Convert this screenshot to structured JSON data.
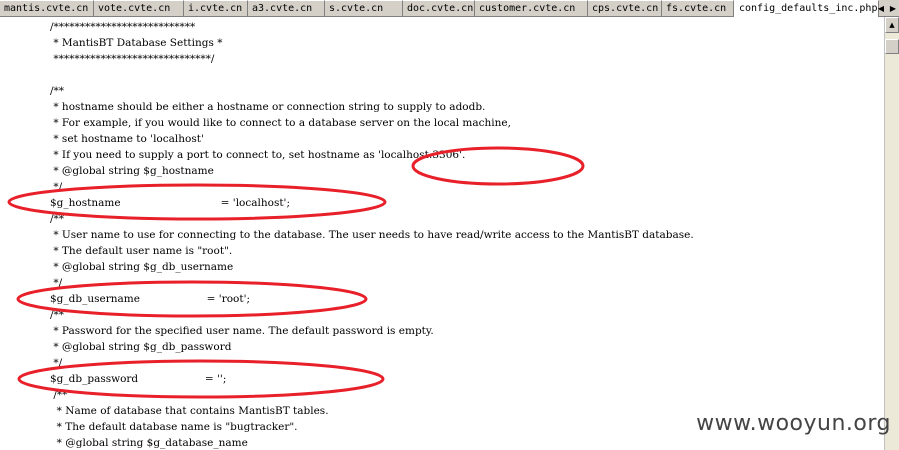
{
  "tabs": [
    {
      "label": "mantis.cvte.cn",
      "active": false
    },
    {
      "label": "vote.cvte.cn",
      "active": false
    },
    {
      "label": "i.cvte.cn",
      "active": false
    },
    {
      "label": "a3.cvte.cn",
      "active": false
    },
    {
      "label": "s.cvte.cn",
      "active": false
    },
    {
      "label": "doc.cvte.cn",
      "active": false
    },
    {
      "label": "customer.cvte.cn",
      "active": false
    },
    {
      "label": "cps.cvte.cn",
      "active": false
    },
    {
      "label": "fs.cvte.cn",
      "active": false
    },
    {
      "label": "config_defaults_inc.php",
      "active": true
    }
  ],
  "code_lines": [
    "/***************************",
    " * MantisBT Database Settings *",
    " ******************************/",
    "",
    "/**",
    " * hostname should be either a hostname or connection string to supply to adodb.",
    " * For example, if you would like to connect to a database server on the local machine,",
    " * set hostname to 'localhost'",
    " * If you need to supply a port to connect to, set hostname as 'localhost:3306'.",
    " * @global string $g_hostname",
    " */",
    "$g_hostname                              = 'localhost';",
    "/**",
    " * User name to use for connecting to the database. The user needs to have read/write access to the MantisBT database.",
    " * The default user name is \"root\".",
    " * @global string $g_db_username",
    " */",
    "$g_db_username                    = 'root';",
    "/**",
    " * Password for the specified user name. The default password is empty.",
    " * @global string $g_db_password",
    " */",
    "$g_db_password                    = '';",
    " /**",
    "  * Name of database that contains MantisBT tables.",
    "  * The default database name is \"bugtracker\".",
    "  * @global string $g_database_name"
  ],
  "watermark": "www.wooyun.org",
  "colors": {
    "annotation": "#e8202a",
    "tabbar": "#d4d0c8"
  }
}
